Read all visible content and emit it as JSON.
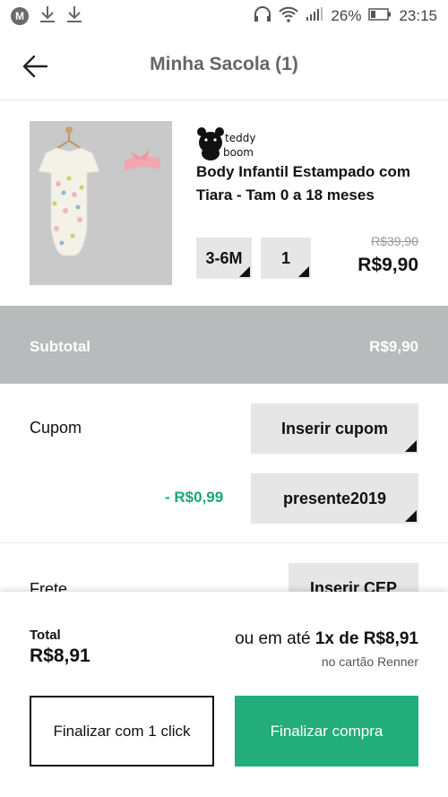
{
  "status_bar": {
    "battery": "26%",
    "time": "23:15",
    "icons": [
      "m-icon",
      "download-icon",
      "download-icon",
      "headphones-icon",
      "wifi-icon",
      "signal-icon",
      "battery-icon"
    ]
  },
  "header": {
    "title": "Minha Sacola (1)",
    "back_icon": "arrow-left-icon"
  },
  "product": {
    "brand": "teddy boom",
    "name": "Body Infantil Estampado com Tiara - Tam 0 a 18 meses",
    "size": "3-6M",
    "quantity": "1",
    "old_price": "R$39,90",
    "price": "R$9,90"
  },
  "subtotal": {
    "label": "Subtotal",
    "value": "R$9,90"
  },
  "coupon": {
    "label": "Cupom",
    "insert_label": "Inserir cupom",
    "discount": "- R$0,99",
    "applied_code": "presente2019"
  },
  "shipping": {
    "label": "Frete",
    "insert_label": "Inserir CEP"
  },
  "summary": {
    "total_label": "Total",
    "total_value": "R$8,91",
    "installments_prefix": "ou em até",
    "installments_value": "1x de R$8,91",
    "card_note": "no cartão Renner"
  },
  "actions": {
    "one_click": "Finalizar com 1 click",
    "checkout": "Finalizar compra"
  },
  "colors": {
    "accent_green": "#22ad7b",
    "discount_green": "#1aa876",
    "subtotal_bg": "#b8babc",
    "button_gray": "#e6e6e6"
  }
}
